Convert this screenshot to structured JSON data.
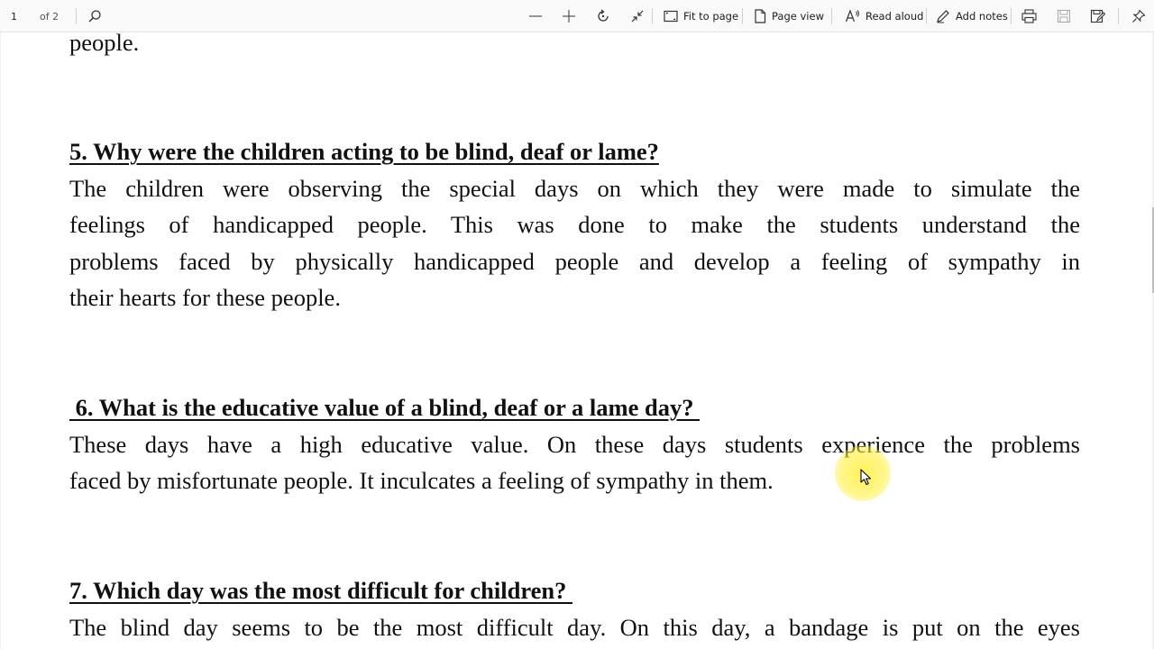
{
  "toolbar": {
    "page_number": "1",
    "page_of": "of 2",
    "fit_to_page": "Fit to page",
    "page_view": "Page view",
    "read_aloud": "Read aloud",
    "add_notes": "Add notes"
  },
  "document": {
    "top_fragment": "people.",
    "q5": {
      "title": "5. Why were the children acting to be blind, deaf or lame?",
      "lines": [
        "The children were observing the special days on which they were made to simulate the",
        "feelings of handicapped people. This was done to make the students understand the",
        "problems faced by physically handicapped people and develop a feeling of sympathy in",
        "their hearts for these people."
      ]
    },
    "q6": {
      "title": " 6. What is the educative value of a blind, deaf or a lame day? ",
      "lines": [
        "These days have a high educative value. On these days students experience the problems",
        "faced by misfortunate people. It inculcates a feeling of sympathy in them."
      ]
    },
    "q7": {
      "title": "7. Which day was the most difficult for children? ",
      "lines": [
        "The blind day seems to be the most difficult day. On this day, a bandage is put on the eyes"
      ]
    }
  },
  "colors": {
    "toolbar_bg": "#f9f9f9",
    "text": "#111111",
    "cursor_highlight": "#fff040"
  }
}
